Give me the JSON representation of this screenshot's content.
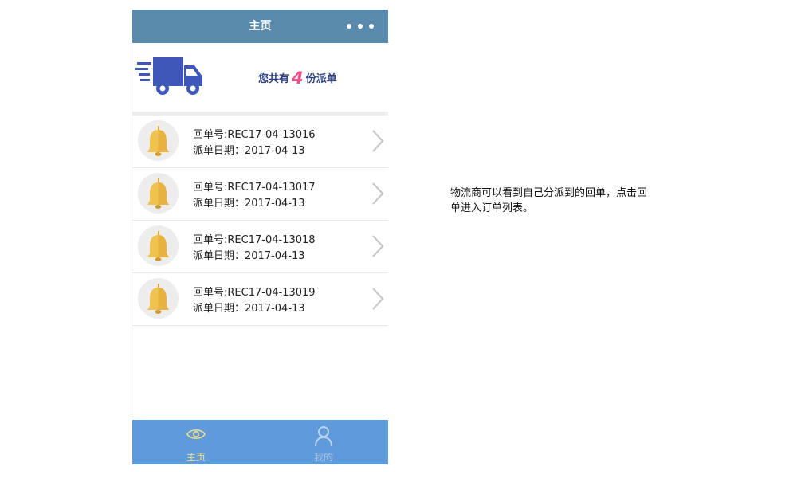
{
  "nav": {
    "title": "主页",
    "menu_icon": "more-dots-icon"
  },
  "banner": {
    "prefix": "您共有",
    "count": "4",
    "suffix": "份派单",
    "icon": "truck-icon",
    "count_color": "#f04f86",
    "text_color": "#2d3f86"
  },
  "orders": [
    {
      "number_label": "回单号:",
      "number": "REC17-04-13016",
      "date_label": "派单日期：",
      "date": "2017-04-13"
    },
    {
      "number_label": "回单号:",
      "number": "REC17-04-13017",
      "date_label": "派单日期：",
      "date": "2017-04-13"
    },
    {
      "number_label": "回单号:",
      "number": "REC17-04-13018",
      "date_label": "派单日期：",
      "date": "2017-04-13"
    },
    {
      "number_label": "回单号:",
      "number": "REC17-04-13019",
      "date_label": "派单日期：",
      "date": "2017-04-13"
    }
  ],
  "tabbar": {
    "home": {
      "label": "主页",
      "icon": "eye-icon"
    },
    "mine": {
      "label": "我的",
      "icon": "user-icon"
    }
  },
  "note": "物流商可以看到自己分派到的回单，点击回单进入订单列表。",
  "colors": {
    "nav": "#5a8aac",
    "tabbar": "#5f9bdb",
    "bell": "#f0c24f",
    "active_tab": "#f3dd8c"
  }
}
